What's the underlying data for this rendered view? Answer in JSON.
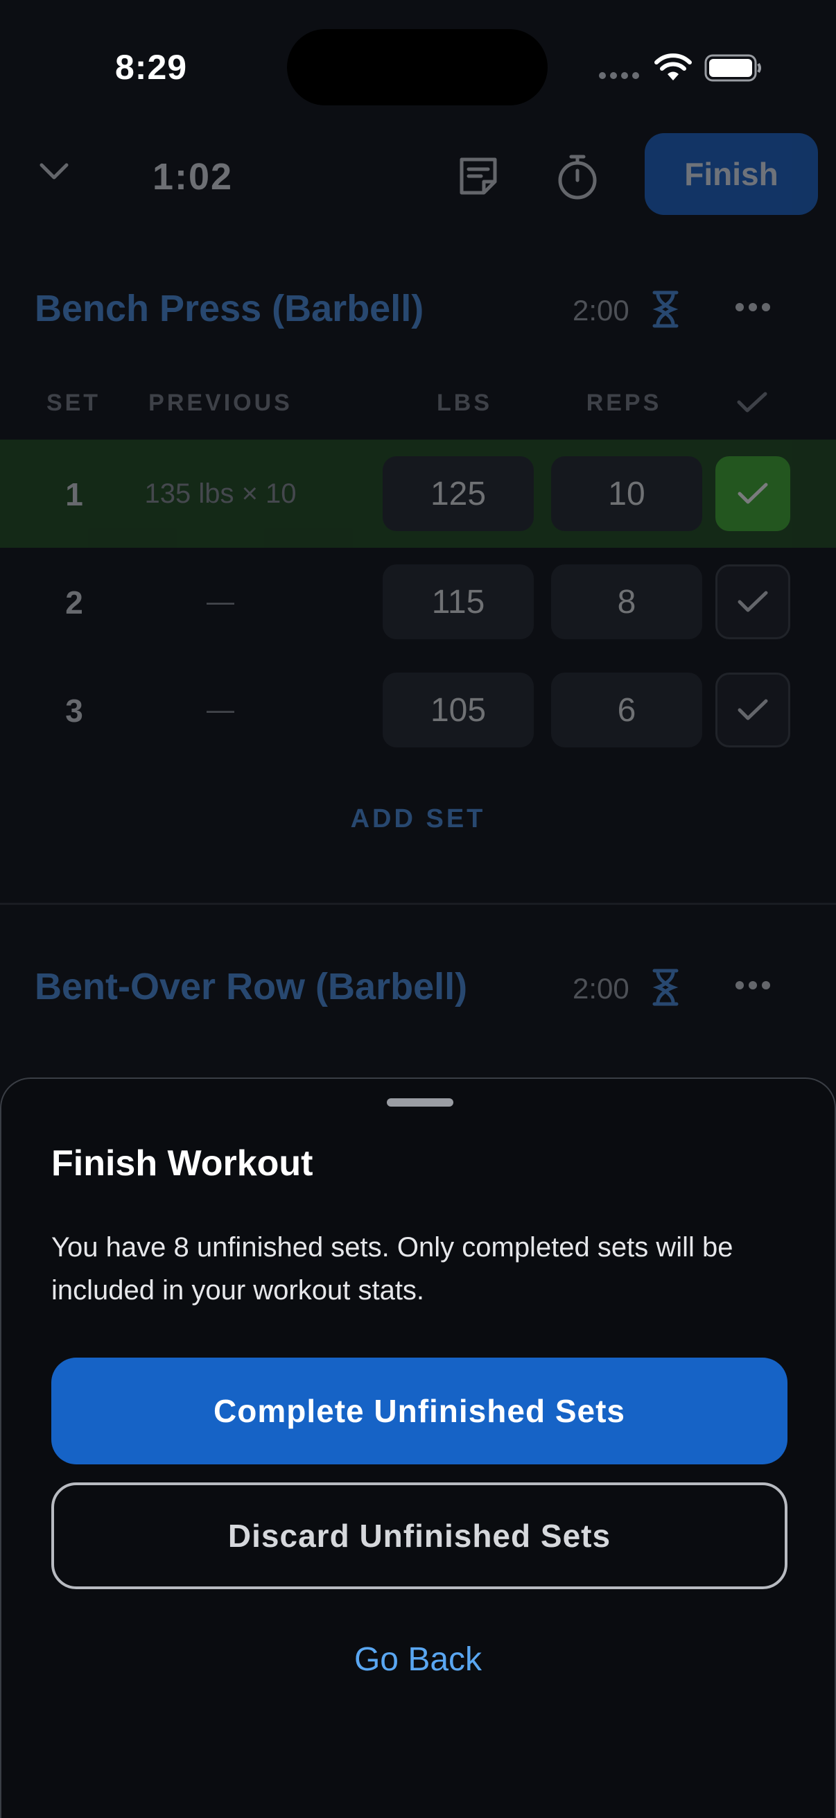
{
  "status_bar": {
    "time": "8:29"
  },
  "workout": {
    "elapsed": "1:02",
    "finish_label": "Finish",
    "exercises": [
      {
        "title": "Bench Press (Barbell)",
        "rest": "2:00"
      },
      {
        "title": "Bent-Over Row (Barbell)",
        "rest": "2:00"
      }
    ],
    "columns": {
      "set": "SET",
      "previous": "PREVIOUS",
      "lbs": "LBS",
      "reps": "REPS"
    },
    "sets": [
      {
        "num": "1",
        "previous": "135 lbs × 10",
        "lbs": "125",
        "reps": "10",
        "completed": true
      },
      {
        "num": "2",
        "previous": "—",
        "lbs": "115",
        "reps": "8",
        "completed": false
      },
      {
        "num": "3",
        "previous": "—",
        "lbs": "105",
        "reps": "6",
        "completed": false
      }
    ],
    "add_set_label": "ADD SET"
  },
  "sheet": {
    "title": "Finish Workout",
    "message": "You have 8 unfinished sets. Only completed sets will be included in your workout stats.",
    "complete_label": "Complete Unfinished Sets",
    "discard_label": "Discard Unfinished Sets",
    "back_label": "Go Back"
  },
  "colors": {
    "accent": "#1663c6",
    "link": "#5aa7f2",
    "exercise_title": "#4a90e2",
    "completed_row": "#1f4a1d",
    "completed_check": "#3fae2f"
  },
  "icons": [
    "wifi-icon",
    "battery-icon",
    "chevron-down-icon",
    "notes-icon",
    "stopwatch-icon",
    "hourglass-icon",
    "more-icon",
    "checkmark-icon"
  ]
}
